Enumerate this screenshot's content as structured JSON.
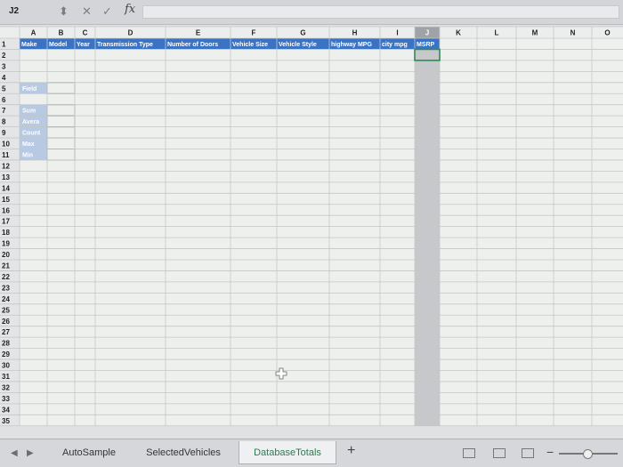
{
  "formula_bar": {
    "cell_reference": "J2",
    "fx_label": "fx",
    "formula_value": "",
    "icons": [
      "stepper-icon",
      "cancel-icon",
      "confirm-icon"
    ]
  },
  "sheet": {
    "active_cell": "J2",
    "column_letters": [
      "A",
      "B",
      "C",
      "D",
      "E",
      "F",
      "G",
      "H",
      "I",
      "J",
      "K",
      "L",
      "M",
      "N",
      "O"
    ],
    "row_numbers": [
      1,
      2,
      3,
      4,
      5,
      6,
      7,
      8,
      9,
      10,
      11,
      12,
      13,
      14,
      15,
      16,
      17,
      18,
      19,
      20,
      21,
      22,
      23,
      24,
      25,
      26,
      27,
      28,
      29,
      30,
      31,
      32,
      33,
      34,
      35
    ],
    "header_row": {
      "row": 1,
      "cells": [
        "Make",
        "Model",
        "Year",
        "Transmission Type",
        "Number of Doors",
        "Vehicle Size",
        "Vehicle Style",
        "highway MPG",
        "city mpg",
        "MSRP"
      ]
    },
    "field_labels": [
      {
        "row": 5,
        "text": "Field"
      },
      {
        "row": 7,
        "text": "Sum"
      },
      {
        "row": 8,
        "text": "Avera"
      },
      {
        "row": 9,
        "text": "Count"
      },
      {
        "row": 10,
        "text": "Max"
      },
      {
        "row": 11,
        "text": "Min"
      }
    ],
    "colors": {
      "header_fill": "#3b73c4",
      "header_text": "#ffffff",
      "field_fill": "#b7c9e3",
      "field_text": "#ffffff",
      "selected_column_fill": "#c6c8cb",
      "selection_border": "#2e8b57",
      "cell_fill": "#eef0ee",
      "grid_line": "#c3c8c4",
      "row_header_fill": "#e3e5e7"
    }
  },
  "tabs": {
    "sheets": [
      "AutoSample",
      "SelectedVehicles",
      "DatabaseTotals"
    ],
    "active": "DatabaseTotals",
    "add_label": "+"
  },
  "status_bar": {
    "view_icons": [
      "normal-view-icon",
      "page-layout-view-icon",
      "page-break-view-icon"
    ],
    "zoom_minus": "−"
  }
}
